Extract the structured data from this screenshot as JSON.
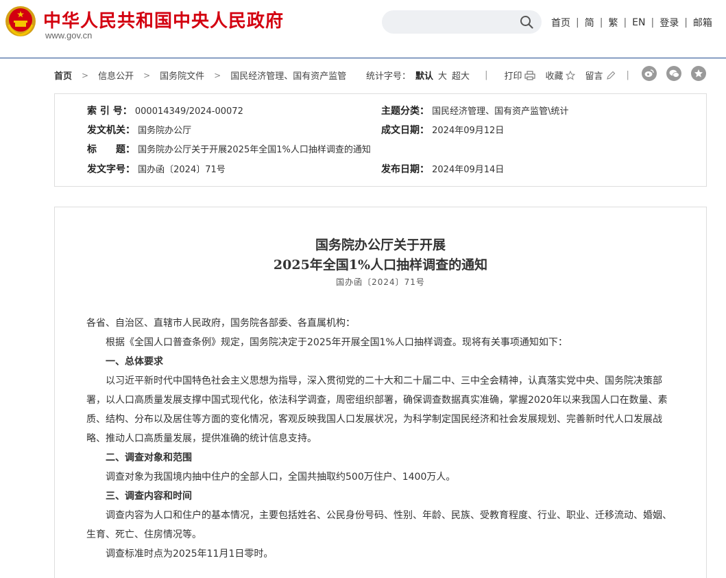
{
  "header": {
    "site_title": "中华人民共和国中央人民政府",
    "site_url": "www.gov.cn",
    "search_placeholder": "",
    "nav": [
      "首页",
      "简",
      "繁",
      "EN",
      "登录",
      "邮箱"
    ]
  },
  "breadcrumb": [
    "首页",
    "信息公开",
    "国务院文件",
    "国民经济管理、国有资产监管"
  ],
  "tools": {
    "font_label": "统计字号：",
    "font_sizes": [
      "默认",
      "大",
      "超大"
    ],
    "print": "打印",
    "favorite": "收藏",
    "comment": "留言"
  },
  "share_icons": [
    "weibo-icon",
    "wechat-icon",
    "qzone-icon"
  ],
  "meta": {
    "index_label": "索 引 号：",
    "index_value": "000014349/2024-00072",
    "topic_label": "主题分类：",
    "topic_value": "国民经济管理、国有资产监管\\统计",
    "issuer_label": "发文机关：",
    "issuer_value": "国务院办公厅",
    "date_written_label": "成文日期：",
    "date_written_value": "2024年09月12日",
    "title_label": "标　　题：",
    "title_value": "国务院办公厅关于开展2025年全国1%人口抽样调查的通知",
    "doc_no_label": "发文字号：",
    "doc_no_value": "国办函〔2024〕71号",
    "published_label": "发布日期：",
    "published_value": "2024年09月14日"
  },
  "article": {
    "title_line1": "国务院办公厅关于开展",
    "title_line2": "2025年全国1%人口抽样调查的通知",
    "doc_number": "国办函〔2024〕71号",
    "salutation": "各省、自治区、直辖市人民政府，国务院各部委、各直属机构：",
    "intro": "根据《全国人口普查条例》规定，国务院决定于2025年开展全国1%人口抽样调查。现将有关事项通知如下：",
    "section1_heading": "一、总体要求",
    "section1_text": "以习近平新时代中国特色社会主义思想为指导，深入贯彻党的二十大和二十届二中、三中全会精神，认真落实党中央、国务院决策部署，以人口高质量发展支撑中国式现代化，依法科学调查，周密组织部署，确保调查数据真实准确，掌握2020年以来我国人口在数量、素质、结构、分布以及居住等方面的变化情况，客观反映我国人口发展状况，为科学制定国民经济和社会发展规划、完善新时代人口发展战略、推动人口高质量发展，提供准确的统计信息支持。",
    "section2_heading": "二、调查对象和范围",
    "section2_text": "调查对象为我国境内抽中住户的全部人口，全国共抽取约500万住户、1400万人。",
    "section3_heading": "三、调查内容和时间",
    "section3_text": "调查内容为人口和住户的基本情况，主要包括姓名、公民身份号码、性别、年龄、民族、受教育程度、行业、职业、迁移流动、婚姻、生育、死亡、住房情况等。",
    "section3_text2": "调查标准时点为2025年11月1日零时。"
  }
}
